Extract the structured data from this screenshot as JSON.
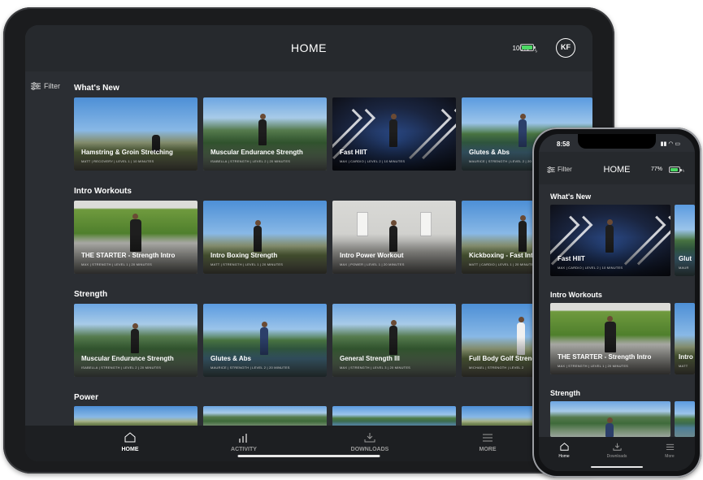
{
  "ipad": {
    "header": {
      "title": "HOME",
      "battery_text": "100%",
      "avatar": "KF"
    },
    "filter_label": "Filter",
    "sections": [
      {
        "title": "What's New",
        "cards": [
          {
            "title": "Hamstring & Groin Stretching",
            "meta": "MATT | RECOVERY | LEVEL 1 | 10 MINUTES"
          },
          {
            "title": "Muscular Endurance Strength",
            "meta": "ISABELLA | STRENGTH | LEVEL 2 | 20 MINUTES"
          },
          {
            "title": "Fast HIIT",
            "meta": "MAX | CARDIO | LEVEL 2 | 10 MINUTES"
          },
          {
            "title": "Glutes & Abs",
            "meta": "MAURICE | STRENGTH | LEVEL 2 | 20 MINUTES"
          }
        ]
      },
      {
        "title": "Intro Workouts",
        "cards": [
          {
            "title": "THE STARTER - Strength Intro",
            "meta": "MAX | STRENGTH | LEVEL 1 | 20 MINUTES"
          },
          {
            "title": "Intro Boxing Strength",
            "meta": "MATT | STRENGTH | LEVEL 1 | 20 MINUTES"
          },
          {
            "title": "Intro Power Workout",
            "meta": "MAX | POWER | LEVEL 1 | 20 MINUTES"
          },
          {
            "title": "Kickboxing - Fast Intro",
            "meta": "MATT | CARDIO | LEVEL 1 | 20 MINUTES"
          }
        ]
      },
      {
        "title": "Strength",
        "cards": [
          {
            "title": "Muscular Endurance Strength",
            "meta": "ISABELLA | STRENGTH | LEVEL 2 | 20 MINUTES"
          },
          {
            "title": "Glutes & Abs",
            "meta": "MAURICE | STRENGTH | LEVEL 2 | 20 MINUTES"
          },
          {
            "title": "General Strength III",
            "meta": "MAX | STRENGTH | LEVEL 3 | 20 MINUTES"
          },
          {
            "title": "Full Body Golf Strength",
            "meta": "MICHAEL | STRENGTH | LEVEL 2"
          }
        ]
      },
      {
        "title": "Power",
        "cards": []
      }
    ],
    "tabs": [
      {
        "label": "HOME",
        "icon": "home-icon"
      },
      {
        "label": "ACTIVITY",
        "icon": "activity-icon"
      },
      {
        "label": "DOWNLOADS",
        "icon": "download-icon"
      },
      {
        "label": "MORE",
        "icon": "menu-icon"
      }
    ]
  },
  "phone": {
    "time": "8:58",
    "header": {
      "title": "HOME",
      "battery_text": "77%"
    },
    "filter_label": "Filter",
    "sections": [
      {
        "title": "What's New",
        "cards": [
          {
            "title": "Fast HIIT",
            "meta": "MAX | CARDIO | LEVEL 2 | 10 MINUTES"
          },
          {
            "title": "Glut",
            "meta": "MAUR"
          }
        ]
      },
      {
        "title": "Intro Workouts",
        "cards": [
          {
            "title": "THE STARTER - Strength Intro",
            "meta": "MAX | STRENGTH | LEVEL 1 | 20 MINUTES"
          },
          {
            "title": "Intro",
            "meta": "MATT"
          }
        ]
      },
      {
        "title": "Strength",
        "cards": []
      }
    ],
    "tabs": [
      {
        "label": "Home",
        "icon": "home-icon"
      },
      {
        "label": "Downloads",
        "icon": "download-icon"
      },
      {
        "label": "More",
        "icon": "menu-icon"
      }
    ]
  },
  "colors": {
    "battery_green": "#4cd964",
    "screen_bg": "#2b2e33",
    "tabbar_bg": "#1d1f22"
  }
}
